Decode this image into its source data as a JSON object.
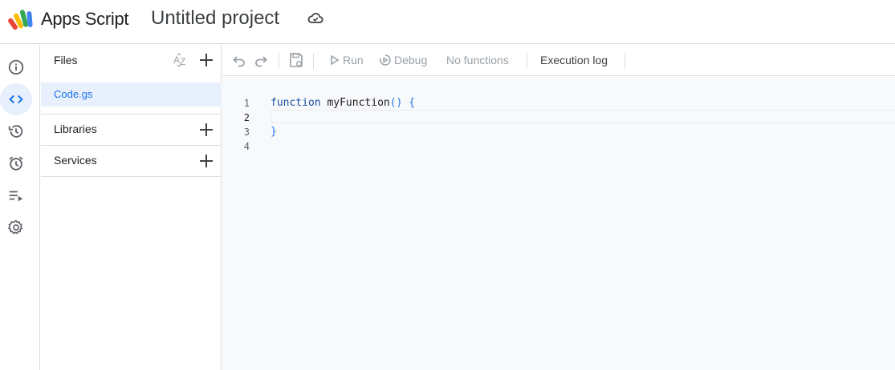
{
  "header": {
    "app_name": "Apps Script",
    "project_title": "Untitled project"
  },
  "rail": {
    "items": [
      "overview-icon",
      "editor-icon",
      "history-icon",
      "triggers-icon",
      "executions-icon",
      "settings-icon"
    ],
    "active": "editor"
  },
  "panel": {
    "files_label": "Files",
    "file_name": "Code.gs",
    "libraries_label": "Libraries",
    "services_label": "Services",
    "sort_icon": "sort-az-icon"
  },
  "toolbar": {
    "run_label": "Run",
    "debug_label": "Debug",
    "function_select": "No functions",
    "execution_log_label": "Execution log"
  },
  "editor": {
    "line_numbers": [
      "1",
      "2",
      "3",
      "4"
    ],
    "code": {
      "line1_keyword": "function",
      "line1_name": "myFunction",
      "line1_parens": "()",
      "line1_brace": "{",
      "line3_brace": "}"
    }
  },
  "colors": {
    "accent": "#1a73e8",
    "active_bg": "#e8f0fe",
    "editor_bg": "#f8f9fa",
    "border": "#dadce0"
  }
}
